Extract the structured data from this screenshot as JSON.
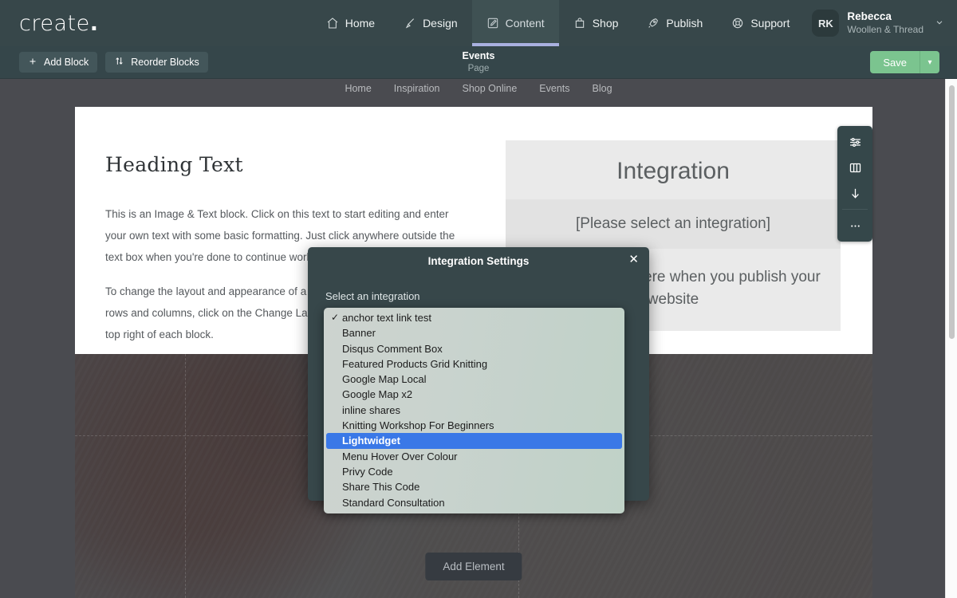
{
  "topnav": {
    "logo": "create",
    "logo_dot": ".",
    "items": [
      {
        "label": "Home",
        "icon": "home-icon",
        "active": false
      },
      {
        "label": "Design",
        "icon": "brush-icon",
        "active": false
      },
      {
        "label": "Content",
        "icon": "edit-square-icon",
        "active": true
      },
      {
        "label": "Shop",
        "icon": "bag-icon",
        "active": false
      },
      {
        "label": "Publish",
        "icon": "rocket-icon",
        "active": false
      },
      {
        "label": "Support",
        "icon": "lifebuoy-icon",
        "active": false
      }
    ],
    "user": {
      "initials": "RK",
      "name": "Rebecca",
      "org": "Woollen & Thread",
      "chevron": "⌄"
    }
  },
  "subbar": {
    "add_block": "Add Block",
    "add_block_icon": "plus-icon",
    "reorder_blocks": "Reorder Blocks",
    "reorder_icon": "sort-arrows-icon",
    "page_title": "Events",
    "page_type": "Page",
    "save_label": "Save",
    "save_caret": "▾"
  },
  "site_nav": {
    "items": [
      "Home",
      "Inspiration",
      "Shop Online",
      "Events",
      "Blog"
    ]
  },
  "canvas": {
    "heading": "Heading Text",
    "paragraph1": "This is an Image & Text block. Click on this text to start editing and enter your own text with some basic formatting. Just click anywhere outside the text box when you're done to continue working on the rest of your page.",
    "paragraph2": "To change the layout and appearance of a block, including the number of rows and columns, click on the Change Layout button in the toolbar at the top right of each block.",
    "integration_title": "Integration",
    "integration_placeholder": "[Please select an integration]",
    "integration_note": "This will appear here when you publish your website",
    "add_element": "Add Element"
  },
  "block_toolbar": {
    "buttons": [
      {
        "name": "block-settings-icon",
        "title": "Block Settings"
      },
      {
        "name": "change-layout-icon",
        "title": "Change Layout"
      },
      {
        "name": "move-down-icon",
        "title": "Move Down"
      },
      {
        "name": "more-options-icon",
        "title": "More"
      }
    ]
  },
  "modal": {
    "title": "Integration Settings",
    "close_icon": "close-icon",
    "close_glyph": "✕",
    "select_label": "Select an integration"
  },
  "dropdown": {
    "selected": "Lightwidget",
    "checked": "anchor text link test",
    "options": [
      "anchor text link test",
      "Banner",
      "Disqus Comment Box",
      "Featured Products Grid Knitting",
      "Google Map Local",
      "Google Map x2",
      "inline shares",
      "Knitting Workshop For Beginners",
      "Lightwidget",
      "Menu Hover Over Colour",
      "Privy Code",
      "Share This Code",
      "Standard Consultation"
    ]
  },
  "colors": {
    "nav_bg": "#37474a",
    "subbar_bg": "#35464a",
    "accent_green": "#7bc48f",
    "active_underline": "#a9b0e0",
    "selection_blue": "#3a78e7",
    "canvas_bg": "#ffffff",
    "preview_bg": "#4a4b50"
  }
}
